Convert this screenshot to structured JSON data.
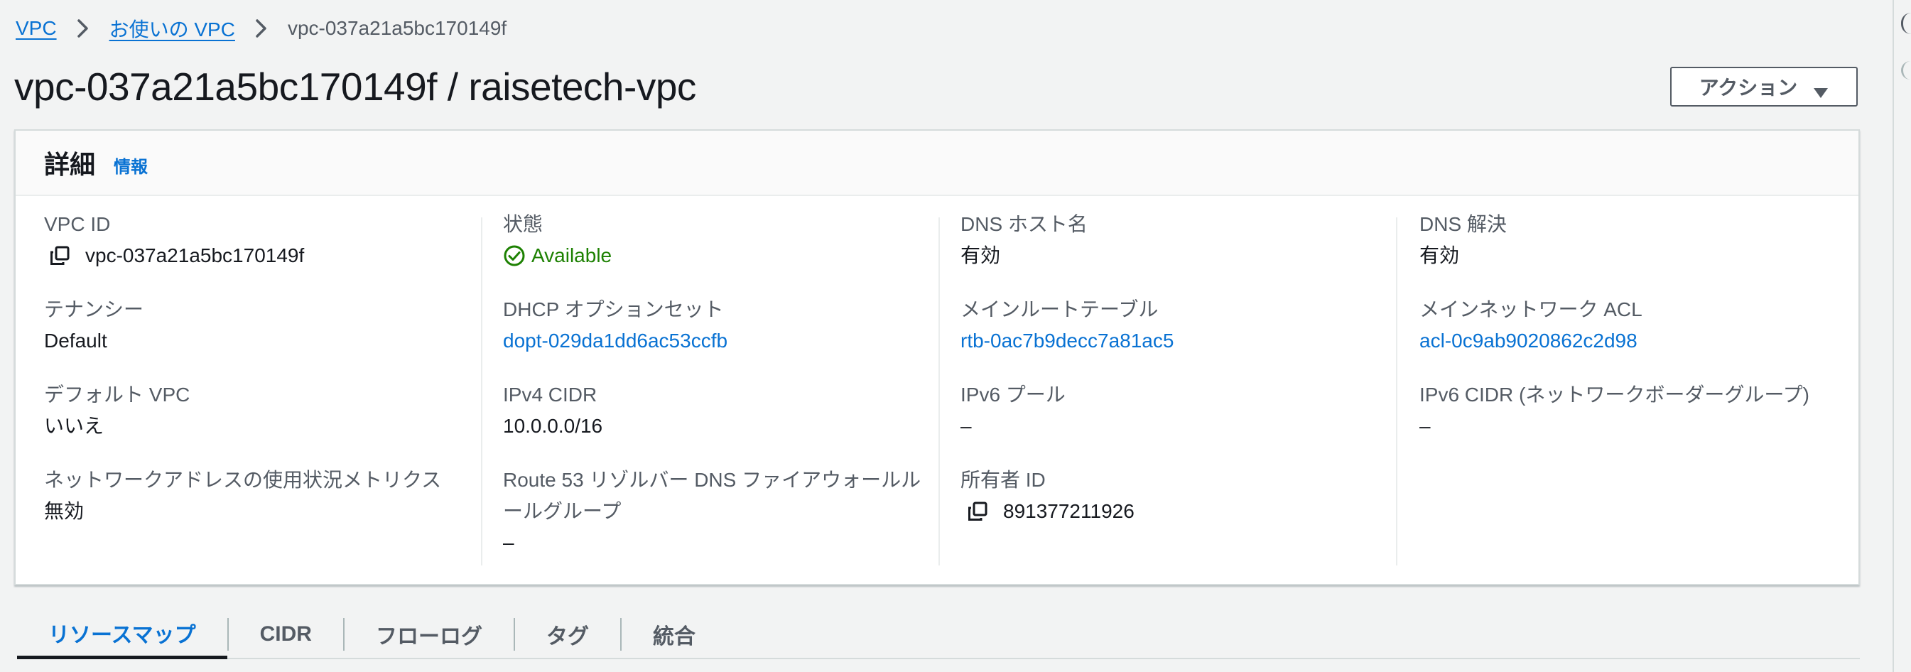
{
  "breadcrumb": {
    "items": [
      {
        "label": "VPC"
      },
      {
        "label": "お使いの VPC"
      }
    ],
    "current": "vpc-037a21a5bc170149f"
  },
  "page": {
    "title": "vpc-037a21a5bc170149f / raisetech-vpc"
  },
  "actions_button": {
    "label": "アクション"
  },
  "details": {
    "title": "詳細",
    "info_link": "情報",
    "columns": [
      {
        "fields": [
          {
            "label": "VPC ID",
            "value": "vpc-037a21a5bc170149f",
            "icon": "copy-icon"
          },
          {
            "label": "テナンシー",
            "value": "Default"
          },
          {
            "label": "デフォルト VPC",
            "value": "いいえ"
          },
          {
            "label": "ネットワークアドレスの使用状況メトリクス",
            "value": "無効"
          }
        ]
      },
      {
        "fields": [
          {
            "label": "状態",
            "value": "Available",
            "icon": "check-circle-icon",
            "status_color": "#1d8102"
          },
          {
            "label": "DHCP オプションセット",
            "value": "dopt-029da1dd6ac53ccfb",
            "link": true
          },
          {
            "label": "IPv4 CIDR",
            "value": "10.0.0.0/16"
          },
          {
            "label_line1": "Route 53 リゾルバー DNS ファイアウォールル",
            "label_line2": "ールグループ",
            "value": "–"
          }
        ]
      },
      {
        "fields": [
          {
            "label": "DNS ホスト名",
            "value": "有効"
          },
          {
            "label": "メインルートテーブル",
            "value": "rtb-0ac7b9decc7a81ac5",
            "link": true
          },
          {
            "label": "IPv6 プール",
            "value": "–"
          },
          {
            "label": "所有者 ID",
            "value": "891377211926",
            "icon": "copy-icon"
          }
        ]
      },
      {
        "fields": [
          {
            "label": "DNS 解決",
            "value": "有効"
          },
          {
            "label": "メインネットワーク ACL",
            "value": "acl-0c9ab9020862c2d98",
            "link": true
          },
          {
            "label": "IPv6 CIDR (ネットワークボーダーグループ)",
            "value": "–"
          }
        ]
      }
    ]
  },
  "tabs": [
    {
      "label": "リソースマップ",
      "active": true
    },
    {
      "label": "CIDR"
    },
    {
      "label": "フローログ"
    },
    {
      "label": "タグ"
    },
    {
      "label": "統合"
    }
  ],
  "colors": {
    "link": "#0972d3",
    "text": "#16191f",
    "label": "#545b64",
    "success": "#1d8102",
    "background": "#f2f3f3"
  }
}
